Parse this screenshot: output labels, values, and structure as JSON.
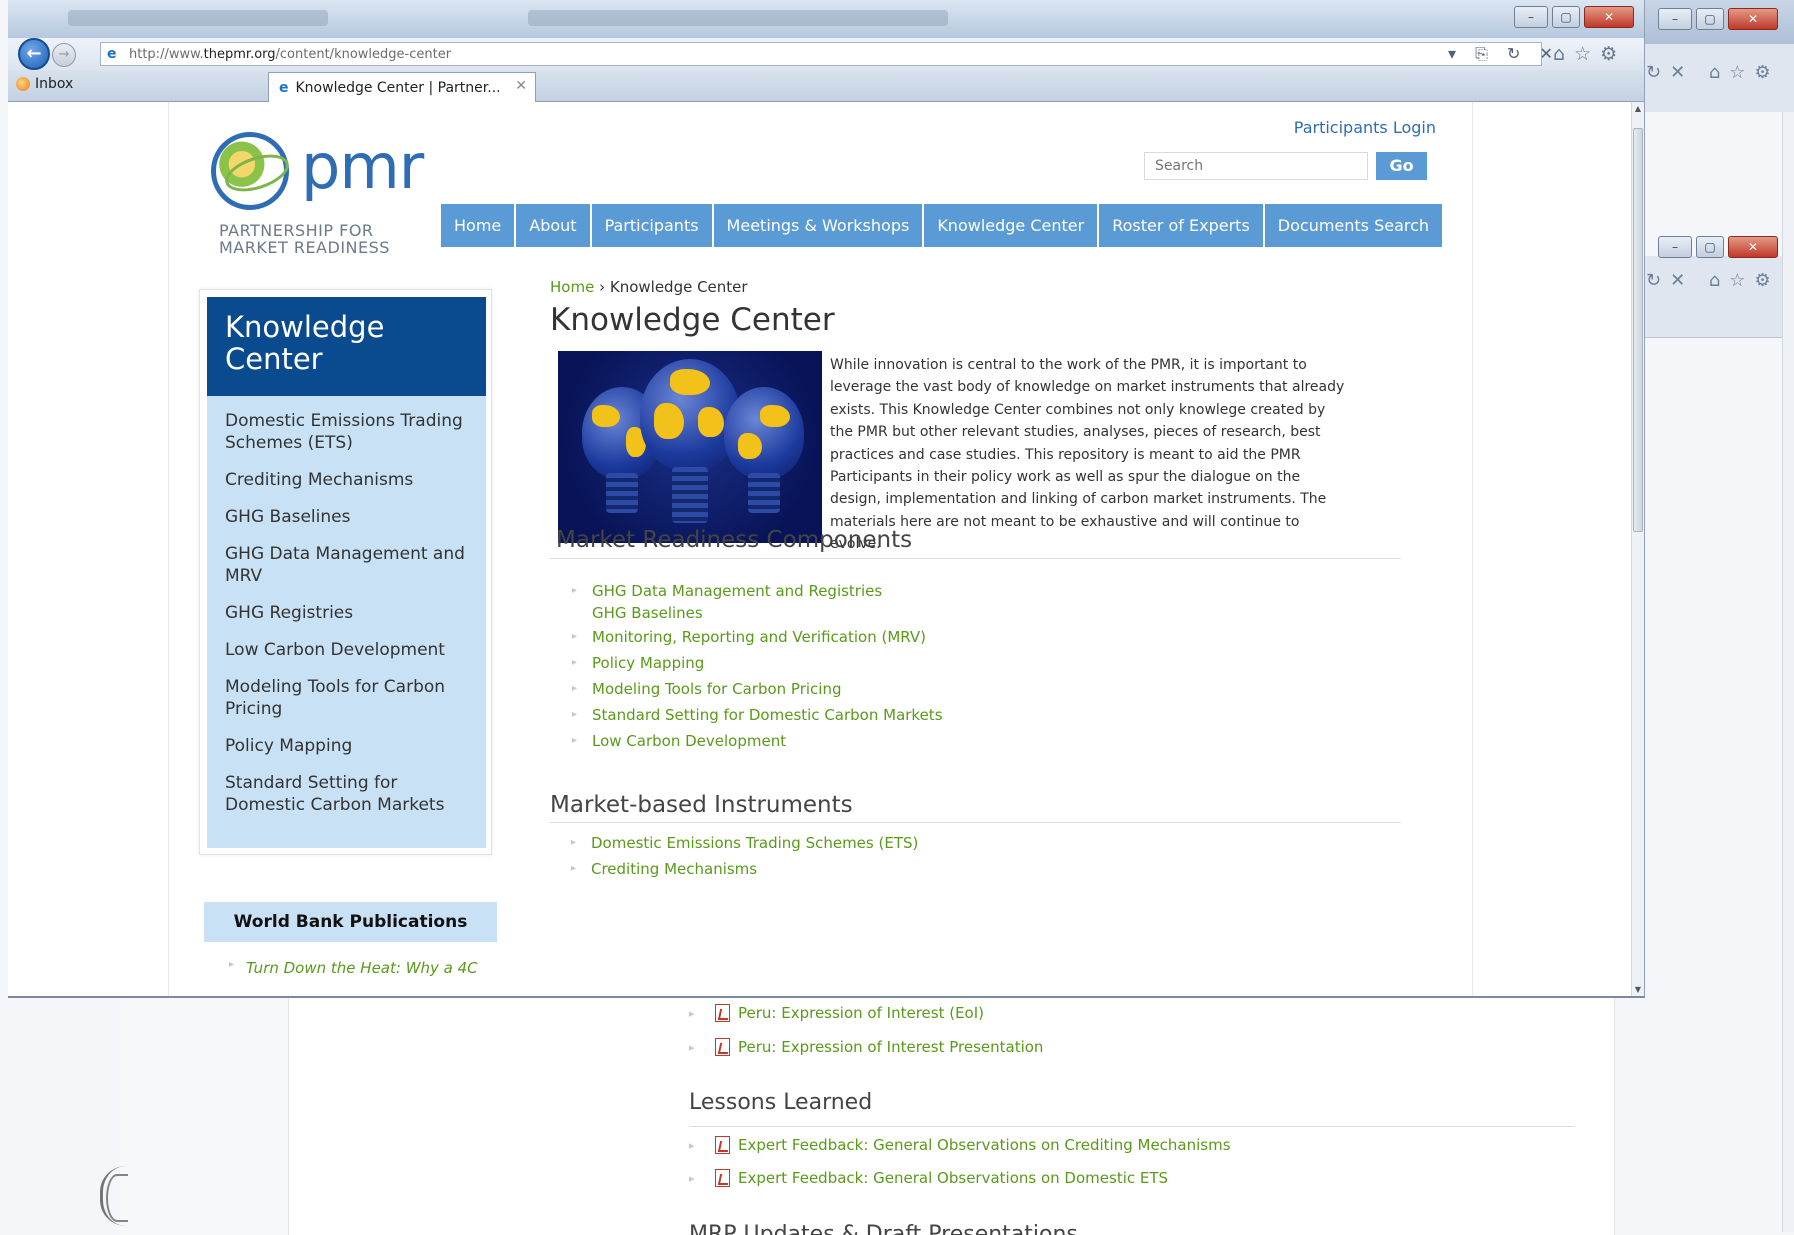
{
  "browser": {
    "url_prefix": "http://www.",
    "url_domain": "thepmr.org",
    "url_path": "/content/knowledge-center",
    "address_commands": "▾ ⎘ ↻ ✕",
    "favorites_bar_item": "Inbox",
    "active_tab_title": "Knowledge Center | Partner...",
    "tab_close": "✕"
  },
  "site": {
    "logo_word": "pmr",
    "logo_tagline": "PARTNERSHIP FOR MARKET READINESS",
    "participants_login": "Participants Login",
    "search_placeholder": "Search",
    "search_button": "Go",
    "nav": [
      "Home",
      "About",
      "Participants",
      "Meetings & Workshops",
      "Knowledge Center",
      "Roster of Experts",
      "Documents Search"
    ]
  },
  "sidebar": {
    "title": "Knowledge Center",
    "items": [
      "Domestic Emissions Trading Schemes (ETS)",
      "Crediting Mechanisms",
      "GHG Baselines",
      "GHG Data Management and MRV",
      "GHG Registries",
      "Low Carbon Development",
      "Modeling Tools for Carbon Pricing",
      "Policy Mapping",
      "Standard Setting for Domestic Carbon Markets"
    ],
    "world_bank_heading": "World Bank Publications",
    "world_bank_item": "Turn Down the Heat: Why a 4C"
  },
  "main": {
    "breadcrumb_home": "Home",
    "breadcrumb_sep": "›",
    "breadcrumb_current": "Knowledge Center",
    "title": "Knowledge Center",
    "intro": "While innovation is central to the work of the PMR, it is important to leverage the vast body of knowledge on market instruments that already exists. This Knowledge Center combines not only knowlege created by the PMR but other relevant studies, analyses, pieces of research, best practices and case studies. This repository is meant to aid the PMR Participants in their policy work as well as spur the dialogue on the design, implementation and linking of carbon market instruments. The materials here are not meant to be exhaustive and will continue to evolve.",
    "mrc_heading": "Market Readiness Components",
    "mrc_links": [
      "GHG Data Management and Registries",
      "GHG Baselines",
      "Monitoring, Reporting and Verification (MRV)",
      "Policy Mapping",
      "Modeling Tools for Carbon Pricing",
      "Standard Setting for Domestic Carbon Markets",
      "Low Carbon Development"
    ],
    "mbi_heading": "Market-based Instruments",
    "mbi_links": [
      "Domestic Emissions Trading Schemes (ETS)",
      "Crediting Mechanisms"
    ]
  },
  "lower_page": {
    "doc_links_top": [
      "Peru: Expression of Interest (EoI)",
      "Peru: Expression of Interest Presentation"
    ],
    "lessons_heading": "Lessons Learned",
    "lessons_links": [
      "Expert Feedback: General Observations on Crediting Mechanisms",
      "Expert Feedback: General Observations on Domestic ETS"
    ],
    "next_heading": "MRP Updates & Draft Presentations"
  },
  "icons": {
    "back": "back-arrow-icon",
    "forward": "forward-arrow-icon",
    "home": "home-icon",
    "favorites": "star-icon",
    "tools": "gear-icon",
    "pdf": "pdf-icon"
  },
  "colors": {
    "nav_blue": "#5b9bd5",
    "sidebar_header": "#0a4a8f",
    "sidebar_bg": "#c9e1f5",
    "link_green": "#5a9a1a"
  }
}
